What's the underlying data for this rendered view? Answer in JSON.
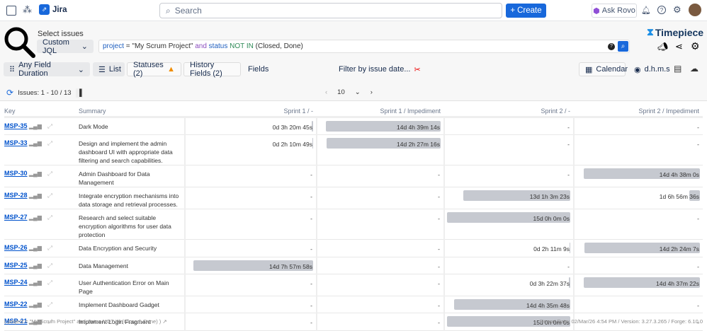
{
  "topbar": {
    "app_name": "Jira",
    "search_placeholder": "Search",
    "create_label": "Create",
    "rovo_label": "Ask Rovo"
  },
  "toolbar": {
    "select_label": "Select issues",
    "mode": "Custom JQL",
    "jql": {
      "p1": "project",
      "p2": " = \"My Scrum Project\" ",
      "p3": "and",
      "p4": " status ",
      "p5": "NOT IN",
      "p6": " (Closed, Done)"
    },
    "brand": "Timepiece",
    "duration_label": "Any Field Duration",
    "list_label": "List",
    "statuses_label": "Statuses (2)",
    "history_label": "History Fields (2)",
    "fields_label": "Fields",
    "filter_label": "Filter by issue date...",
    "calendar_label": "Calendar",
    "format_label": "d.h.m.s"
  },
  "pager": {
    "issues": "Issues: 1 - 10 / 13",
    "page_size": "10"
  },
  "columns": [
    "Key",
    "Summary",
    "Sprint 1 / -",
    "Sprint 1 / Impediment",
    "Sprint 2 / -",
    "Sprint 2 / Impediment"
  ],
  "rows": [
    {
      "key": "MSP-35",
      "summary": "Dark Mode",
      "d": [
        "0d 3h 20m 45s",
        "14d 4h 39m 14s",
        "-",
        "-"
      ]
    },
    {
      "key": "MSP-33",
      "summary": "Design and implement the admin dashboard UI with appropriate data filtering and search capabilities.",
      "d": [
        "0d 2h 10m 49s",
        "14d 2h 27m 16s",
        "-",
        "-"
      ]
    },
    {
      "key": "MSP-30",
      "summary": "Admin Dashboard for Data Management",
      "d": [
        "-",
        "-",
        "-",
        "14d 4h 38m 0s"
      ]
    },
    {
      "key": "MSP-28",
      "summary": "Integrate encryption mechanisms into data storage and retrieval processes.",
      "d": [
        "-",
        "-",
        "13d 1h 3m 23s",
        "1d 6h 56m 36s"
      ]
    },
    {
      "key": "MSP-27",
      "summary": "Research and select suitable encryption algorithms for user data protection",
      "d": [
        "-",
        "-",
        "15d 0h 0m 0s",
        "-"
      ]
    },
    {
      "key": "MSP-26",
      "summary": "Data Encryption and Security",
      "d": [
        "-",
        "-",
        "0d 2h 11m 9s",
        "14d 2h 24m 7s"
      ]
    },
    {
      "key": "MSP-25",
      "summary": "Data Management",
      "d": [
        "14d 7h 57m 58s",
        "-",
        "-",
        "-"
      ]
    },
    {
      "key": "MSP-24",
      "summary": "User Authentication Error on Main Page",
      "d": [
        "-",
        "-",
        "0d 3h 22m 37s",
        "14d 4h 37m 22s"
      ]
    },
    {
      "key": "MSP-22",
      "summary": "Implement Dashboard Gadget",
      "d": [
        "-",
        "-",
        "14d 4h 35m 48s",
        "-"
      ]
    },
    {
      "key": "MSP-21",
      "summary": "Implement Login Fragment",
      "d": [
        "-",
        "-",
        "15d 0h 0m 0s",
        "-"
      ]
    }
  ],
  "footer": {
    "query": "( project = \"My Scrum Project\" and status NOT IN (Closed, Done) )",
    "report": "Report Date: 02/Mar/26 4:54 PM / Version: 3.27.3.265 / Forge: 6.10.0"
  }
}
